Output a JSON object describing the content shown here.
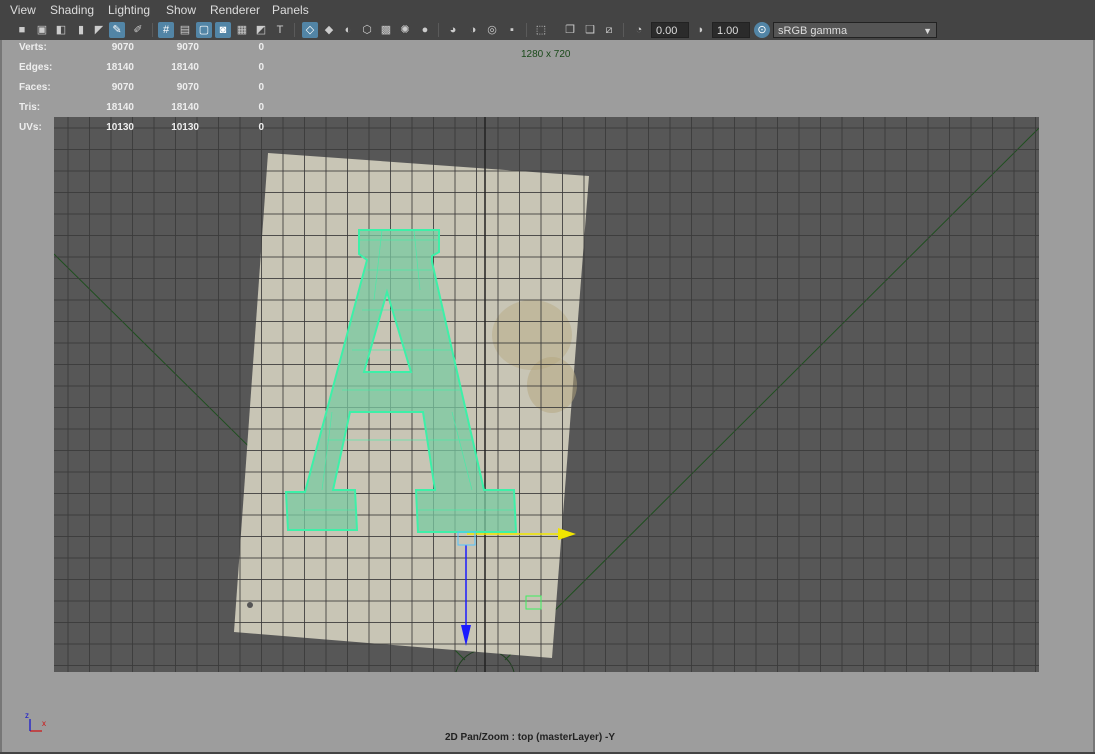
{
  "menubar": {
    "items": [
      "View",
      "Shading",
      "Lighting",
      "Show",
      "Renderer",
      "Panels"
    ]
  },
  "toolbar": {
    "exposure_value": "0.00",
    "gamma_value": "1.00",
    "colorspace_value": "sRGB gamma",
    "icons": [
      "camera-icon",
      "camera-attributes-icon",
      "bookmark-icon",
      "image-plane-icon",
      "2d-pan-zoom-icon",
      "grease-pencil-icon",
      "grid-icon",
      "film-gate-icon",
      "resolution-gate-icon",
      "gate-mask-icon",
      "field-chart-icon",
      "safe-action-icon",
      "safe-title-icon",
      "wireframe-icon",
      "smooth-shade-icon",
      "default-material-icon",
      "bounding-box-icon",
      "textured-icon",
      "use-all-lights-icon",
      "shadows-icon",
      "screen-space-ao-icon",
      "motion-blur-icon",
      "anti-aliasing-icon",
      "depth-of-field-icon",
      "isolate-select-icon",
      "xray-icon",
      "xray-active-components-icon",
      "xray-joints-icon",
      "exposure-icon",
      "gamma-icon",
      "color-management-icon",
      "colorspace-dropdown-arrow-icon"
    ]
  },
  "hud": {
    "rows": [
      {
        "label": "Verts:",
        "values": [
          "9070",
          "9070",
          "0"
        ]
      },
      {
        "label": "Edges:",
        "values": [
          "18140",
          "18140",
          "0"
        ]
      },
      {
        "label": "Faces:",
        "values": [
          "9070",
          "9070",
          "0"
        ]
      },
      {
        "label": "Tris:",
        "values": [
          "18140",
          "18140",
          "0"
        ]
      },
      {
        "label": "UVs:",
        "values": [
          "10130",
          "10130",
          "0"
        ]
      }
    ]
  },
  "viewport": {
    "resolution": "1280 x 720",
    "camera_label": "2D Pan/Zoom : top (masterLayer) -Y",
    "axis_labels": [
      "x",
      "z"
    ],
    "colors": {
      "background": "#9d9d9d",
      "gate": "#575757",
      "grid": "#3a3a3a",
      "wireframe": "#3df0a8",
      "manipulator_x": "#f2e600",
      "manipulator_z": "#1a1aff"
    }
  }
}
